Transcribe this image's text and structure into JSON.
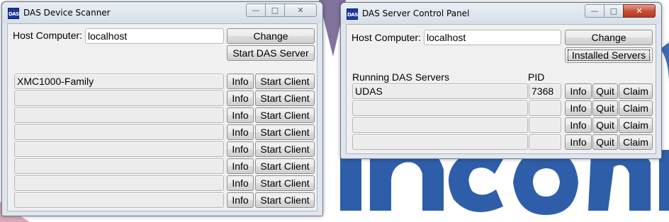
{
  "scanner": {
    "title": "DAS Device Scanner",
    "icon_text": "DAS",
    "host_label": "Host Computer:",
    "host_value": "localhost",
    "change_label": "Change",
    "start_server_label": "Start DAS Server",
    "devices": [
      {
        "name": "XMC1000-Family",
        "info": "Info",
        "start": "Start Client"
      },
      {
        "name": "",
        "info": "Info",
        "start": "Start Client"
      },
      {
        "name": "",
        "info": "Info",
        "start": "Start Client"
      },
      {
        "name": "",
        "info": "Info",
        "start": "Start Client"
      },
      {
        "name": "",
        "info": "Info",
        "start": "Start Client"
      },
      {
        "name": "",
        "info": "Info",
        "start": "Start Client"
      },
      {
        "name": "",
        "info": "Info",
        "start": "Start Client"
      },
      {
        "name": "",
        "info": "Info",
        "start": "Start Client"
      }
    ]
  },
  "control": {
    "title": "DAS Server Control Panel",
    "icon_text": "DAS",
    "host_label": "Host Computer:",
    "host_value": "localhost",
    "change_label": "Change",
    "installed_label": "Installed Servers",
    "running_label": "Running DAS Servers",
    "pid_label": "PID",
    "servers": [
      {
        "name": "UDAS",
        "pid": "7368",
        "info": "Info",
        "quit": "Quit",
        "claim": "Claim"
      },
      {
        "name": "",
        "pid": "",
        "info": "Info",
        "quit": "Quit",
        "claim": "Claim"
      },
      {
        "name": "",
        "pid": "",
        "info": "Info",
        "quit": "Quit",
        "claim": "Claim"
      },
      {
        "name": "",
        "pid": "",
        "info": "Info",
        "quit": "Quit",
        "claim": "Claim"
      }
    ]
  },
  "caption_buttons": {
    "minimize": "—",
    "maximize": "□",
    "close": "✕"
  },
  "icons": [
    "das-app-icon",
    "minimize-icon",
    "maximize-icon",
    "close-icon"
  ],
  "colors": {
    "window_frame": "#dfe6ee",
    "client_bg": "#f0f0f0",
    "close_red": "#c74a35",
    "desktop_logo_blue": "#2a5aa8"
  }
}
